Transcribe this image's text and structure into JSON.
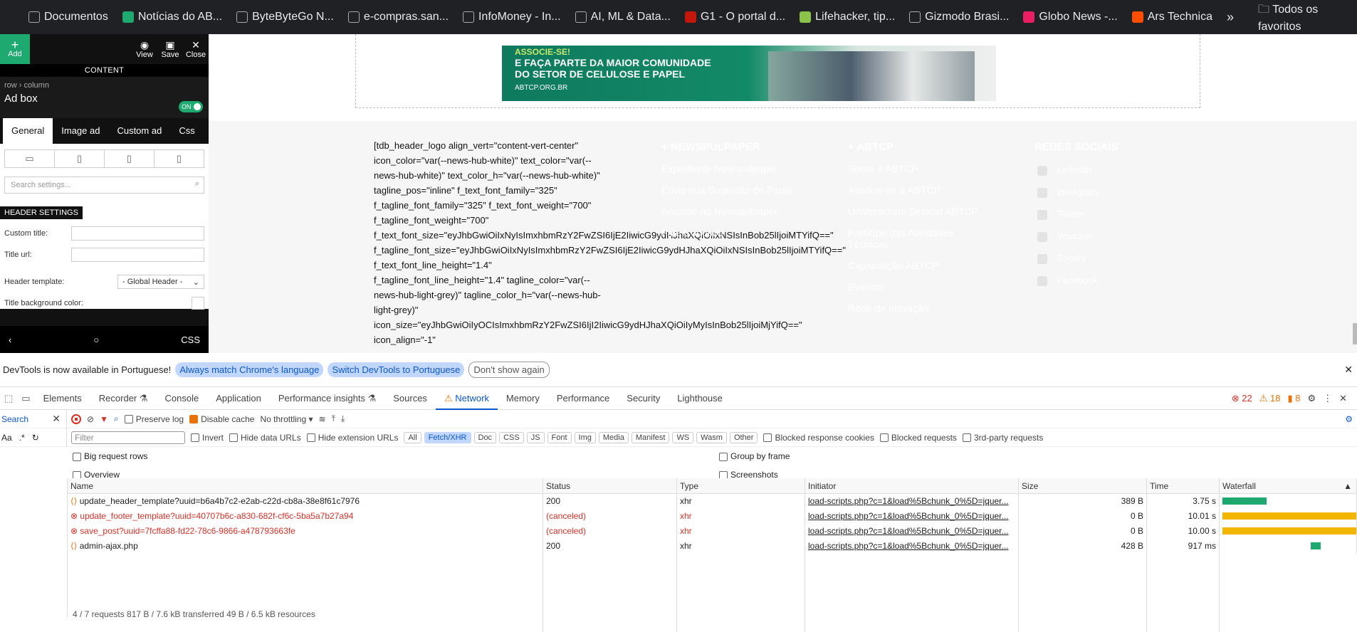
{
  "bookmarks": [
    {
      "label": "Documentos",
      "icon": "doc-icon",
      "color": "#ffffff"
    },
    {
      "label": "Notícias do AB...",
      "icon": "abtcp-icon",
      "color": "#1ea970"
    },
    {
      "label": "ByteByteGo N...",
      "icon": "bytebytego-icon",
      "color": "#ffffff"
    },
    {
      "label": "e-compras.san...",
      "icon": "globe-icon",
      "color": "#ffffff"
    },
    {
      "label": "InfoMoney - In...",
      "icon": "infomoney-icon",
      "color": "#ffffff"
    },
    {
      "label": "AI, ML & Data...",
      "icon": "infoq-icon",
      "color": "#ffffff"
    },
    {
      "label": "G1 - O portal d...",
      "icon": "g1-icon",
      "color": "#c4170c"
    },
    {
      "label": "Lifehacker, tip...",
      "icon": "lifehacker-icon",
      "color": "#8bc34a"
    },
    {
      "label": "Gizmodo Brasi...",
      "icon": "gizmodo-icon",
      "color": "#ffffff"
    },
    {
      "label": "Globo News -...",
      "icon": "globonews-icon",
      "color": "#e91e63"
    },
    {
      "label": "Ars Technica",
      "icon": "ars-icon",
      "color": "#ff4e00"
    }
  ],
  "bookmarks_more": "»",
  "bookmarks_all": "Todos os favoritos",
  "editor": {
    "add": "Add",
    "view": "View",
    "save": "Save",
    "close": "Close",
    "section": "CONTENT",
    "breadcrumb": "row › column",
    "title": "Ad box",
    "toggle": "ON",
    "tabs": [
      "General",
      "Image ad",
      "Custom ad",
      "Css"
    ],
    "search_placeholder": "Search settings...",
    "header_settings": "HEADER SETTINGS",
    "custom_title_label": "Custom title:",
    "title_url_label": "Title url:",
    "header_template_label": "Header template:",
    "header_template_value": "- Global Header -",
    "title_bg_label": "Title background color:",
    "footer_css": "CSS"
  },
  "ad": {
    "line1": "ASSOCIE-SE!",
    "line2": "E FAÇA PARTE DA MAIOR COMUNIDADE",
    "line3": "DO SETOR DE CELULOSE E PAPEL",
    "url": "ABTCP.ORG.BR"
  },
  "shortcode": "[tdb_header_logo align_vert=\"content-vert-center\" icon_color=\"var(--news-hub-white)\" text_color=\"var(--news-hub-white)\" text_color_h=\"var(--news-hub-white)\" tagline_pos=\"inline\" f_text_font_family=\"325\" f_tagline_font_family=\"325\" f_text_font_weight=\"700\" f_tagline_font_weight=\"700\" f_text_font_size=\"eyJhbGwiOiIxNyIsImxhbmRzY2FwZSI6IjE2IiwicG9ydHJhaXQiOiIxNSIsInBob25lIjoiMTYifQ==\" f_tagline_font_size=\"eyJhbGwiOiIxNyIsImxhbmRzY2FwZSI6IjE2IiwicG9ydHJhaXQiOiIxNSIsInBob25lIjoiMTYifQ==\" f_text_font_line_height=\"1.4\" f_tagline_font_line_height=\"1.4\" tagline_color=\"var(--news-hub-light-grey)\" tagline_color_h=\"var(--news-hub-light-grey)\" icon_size=\"eyJhbGwiOiIyOCIsImxhbmRzY2FwZSI6IjI2IiwicG9ydHJhaXQiOiIyMyIsInBob25lIjoiMjYifQ==\" icon_align=\"-1\"",
  "footer_cols": [
    {
      "heading": "+ NEWSPULPAPER",
      "items": [
        "Expediente Newspulpaper",
        "Envie sua Sugestão de Pauta",
        "Anuncie no Newspulpaper",
        "Fale Conosco"
      ]
    },
    {
      "heading": "+ ABTCP",
      "items": [
        "Sobre a ABTCP",
        "Associe-se à ABTCP",
        "Universidade Setorial ABTCP",
        "Participe das Atividades Técnicas",
        "Capacitação ABTCP",
        "Eventos",
        "Rede de Inovação"
      ]
    },
    {
      "heading": "REDES SOCIAIS",
      "items": [
        "Linkedin",
        "Instagram",
        "Twitter",
        "Youtube",
        "Spotify",
        "Facebook"
      ]
    }
  ],
  "devtools": {
    "notice": "DevTools is now available in Portuguese!",
    "btn_match": "Always match Chrome's language",
    "btn_switch": "Switch DevTools to Portuguese",
    "btn_dont": "Don't show again",
    "tabs": [
      "Elements",
      "Recorder ⚗",
      "Console",
      "Application",
      "Performance insights ⚗",
      "Sources",
      "Network",
      "Memory",
      "Performance",
      "Security",
      "Lighthouse"
    ],
    "active_tab": "Network",
    "errors": "22",
    "warnings": "18",
    "infos": "8",
    "search_label": "Search",
    "preserve_log": "Preserve log",
    "disable_cache": "Disable cache",
    "throttling": "No throttling",
    "filter_placeholder": "Filter",
    "invert": "Invert",
    "hide_data_urls": "Hide data URLs",
    "hide_ext_urls": "Hide extension URLs",
    "types": [
      "All",
      "Fetch/XHR",
      "Doc",
      "CSS",
      "JS",
      "Font",
      "Img",
      "Media",
      "Manifest",
      "WS",
      "Wasm",
      "Other"
    ],
    "active_type": "Fetch/XHR",
    "blocked_cookies": "Blocked response cookies",
    "blocked_requests": "Blocked requests",
    "third_party": "3rd-party requests",
    "big_rows": "Big request rows",
    "overview": "Overview",
    "group_frame": "Group by frame",
    "screenshots": "Screenshots",
    "aa": "Aa",
    "regex": ".*",
    "columns": [
      "Name",
      "Status",
      "Type",
      "Initiator",
      "Size",
      "Time",
      "Waterfall"
    ],
    "rows": [
      {
        "name": "update_header_template?uuid=b6a4b7c2-e2ab-c22d-cb8a-38e8f61c7976",
        "status": "200",
        "type": "xhr",
        "initiator": "load-scripts.php?c=1&load%5Bchunk_0%5D=jquer...",
        "size": "389 B",
        "time": "3.75 s",
        "error": false
      },
      {
        "name": "update_footer_template?uuid=40707b6c-a830-682f-cf6c-5ba5a7b27a94",
        "status": "(canceled)",
        "type": "xhr",
        "initiator": "load-scripts.php?c=1&load%5Bchunk_0%5D=jquer...",
        "size": "0 B",
        "time": "10.01 s",
        "error": true
      },
      {
        "name": "save_post?uuid=7fcffa88-fd22-78c6-9866-a478793663fe",
        "status": "(canceled)",
        "type": "xhr",
        "initiator": "load-scripts.php?c=1&load%5Bchunk_0%5D=jquer...",
        "size": "0 B",
        "time": "10.00 s",
        "error": true
      },
      {
        "name": "admin-ajax.php",
        "status": "200",
        "type": "xhr",
        "initiator": "load-scripts.php?c=1&load%5Bchunk_0%5D=jquer...",
        "size": "428 B",
        "time": "917 ms",
        "error": false
      }
    ],
    "summary": "4 / 7 requests   817 B / 7.6 kB transferred   49 B / 6.5 kB resources"
  }
}
